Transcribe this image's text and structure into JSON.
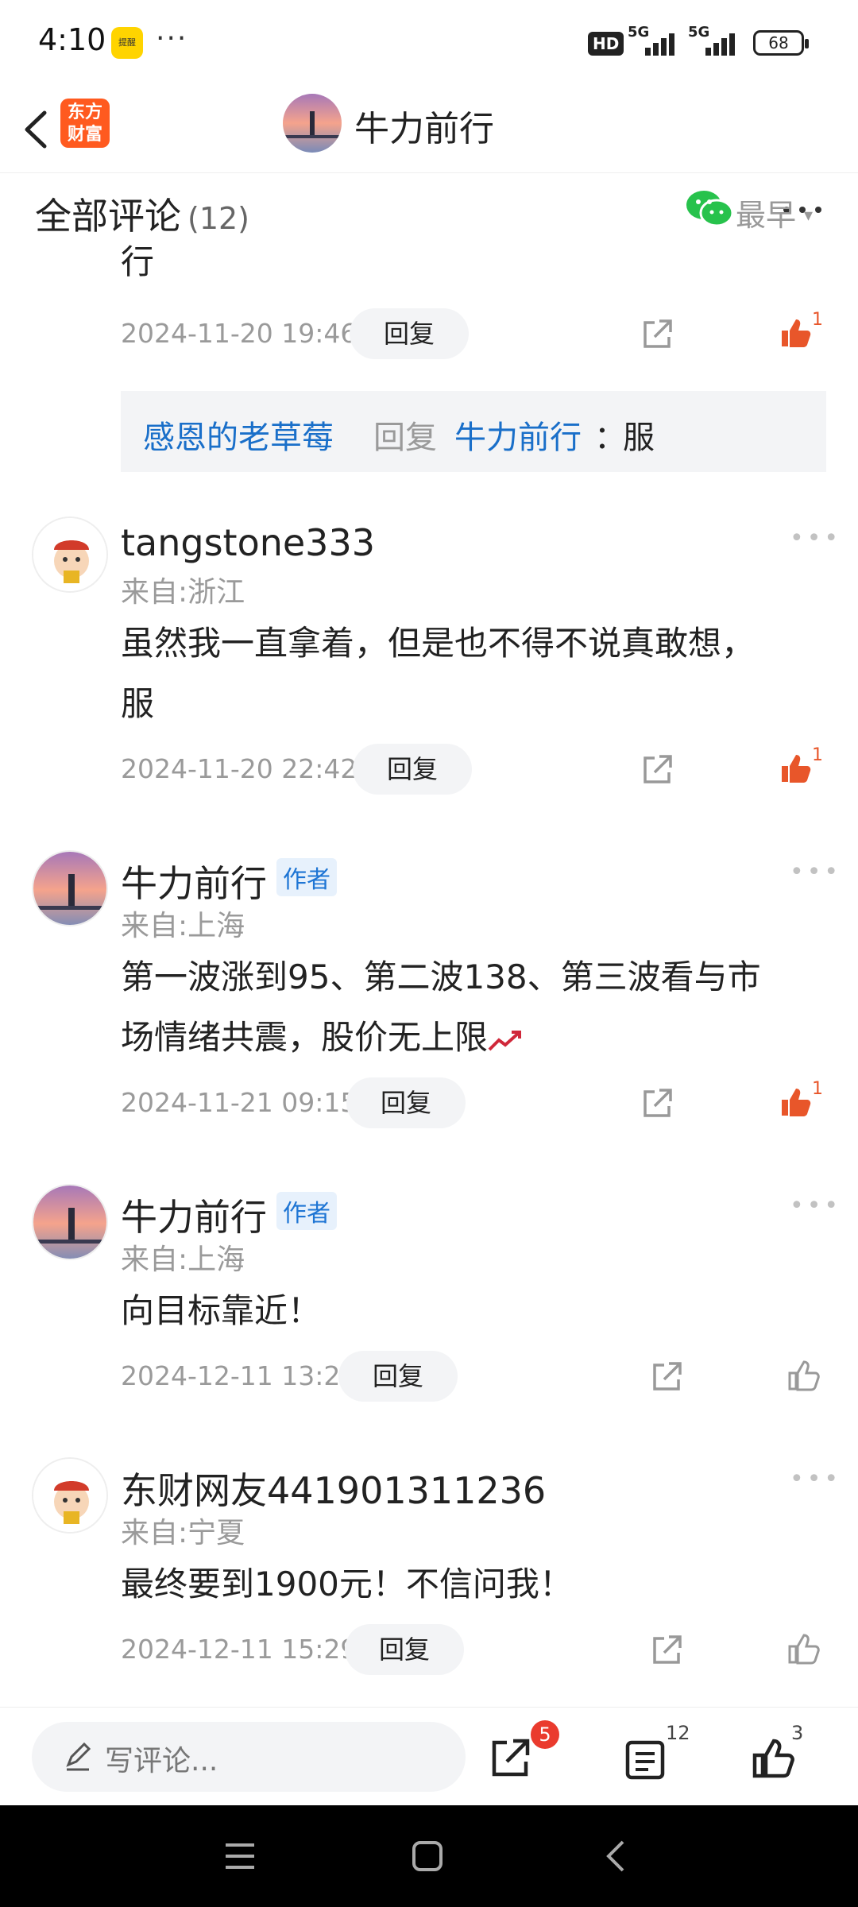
{
  "status": {
    "time": "4:10",
    "app_badge": "提醒",
    "more": "···",
    "hd": "HD",
    "net1": "5G",
    "net2": "5G",
    "battery": "68"
  },
  "nav": {
    "logo": "东方财富",
    "title": "牛力前行"
  },
  "section": {
    "title": "全部评论",
    "count": "(12)",
    "sort": "最早",
    "sort_caret": "▾"
  },
  "prev_comment": {
    "text_tail": "行",
    "date": "2024-11-20 19:46",
    "reply": "回复",
    "likes": "1"
  },
  "sub_reply": {
    "from": "感恩的老草莓",
    "verb": "回复",
    "to": "牛力前行",
    "sep": "：",
    "text": "服"
  },
  "comments": [
    {
      "name": "tangstone333",
      "location": "来自:浙江",
      "text_line1": "虽然我一直拿着，但是也不得不说真敢想，",
      "text_line2": "服",
      "date": "2024-11-20 22:42",
      "reply": "回复",
      "likes": "1"
    },
    {
      "name": "牛力前行",
      "tag": "作者",
      "location": "来自:上海",
      "text_line1": "第一波涨到95、第二波138、第三波看与市",
      "text_line2": "场情绪共震，股价无上限",
      "date": "2024-11-21 09:15",
      "reply": "回复",
      "likes": "1"
    },
    {
      "name": "牛力前行",
      "tag": "作者",
      "location": "来自:上海",
      "text_line1": "向目标靠近！",
      "date": "2024-12-11 13:21",
      "reply": "回复"
    },
    {
      "name": "东财网友441901311236",
      "location": "来自:宁夏",
      "text_line1": "最终要到1900元！不信问我！",
      "date": "2024-12-11 15:29",
      "reply": "回复"
    }
  ],
  "bottom": {
    "placeholder": "写评论...",
    "share_badge": "5",
    "comments_count": "12",
    "likes_count": "3"
  },
  "icons": [
    "back-icon",
    "wechat-icon",
    "more-icon",
    "share-icon",
    "thumb-up-icon",
    "pen-icon",
    "comment-list-icon",
    "menu-icon",
    "home-icon",
    "back-nav-icon"
  ],
  "colors": {
    "accent_orange": "#e8562a",
    "link_blue": "#1a6fc9",
    "logo_orange": "#ff5a1f"
  }
}
